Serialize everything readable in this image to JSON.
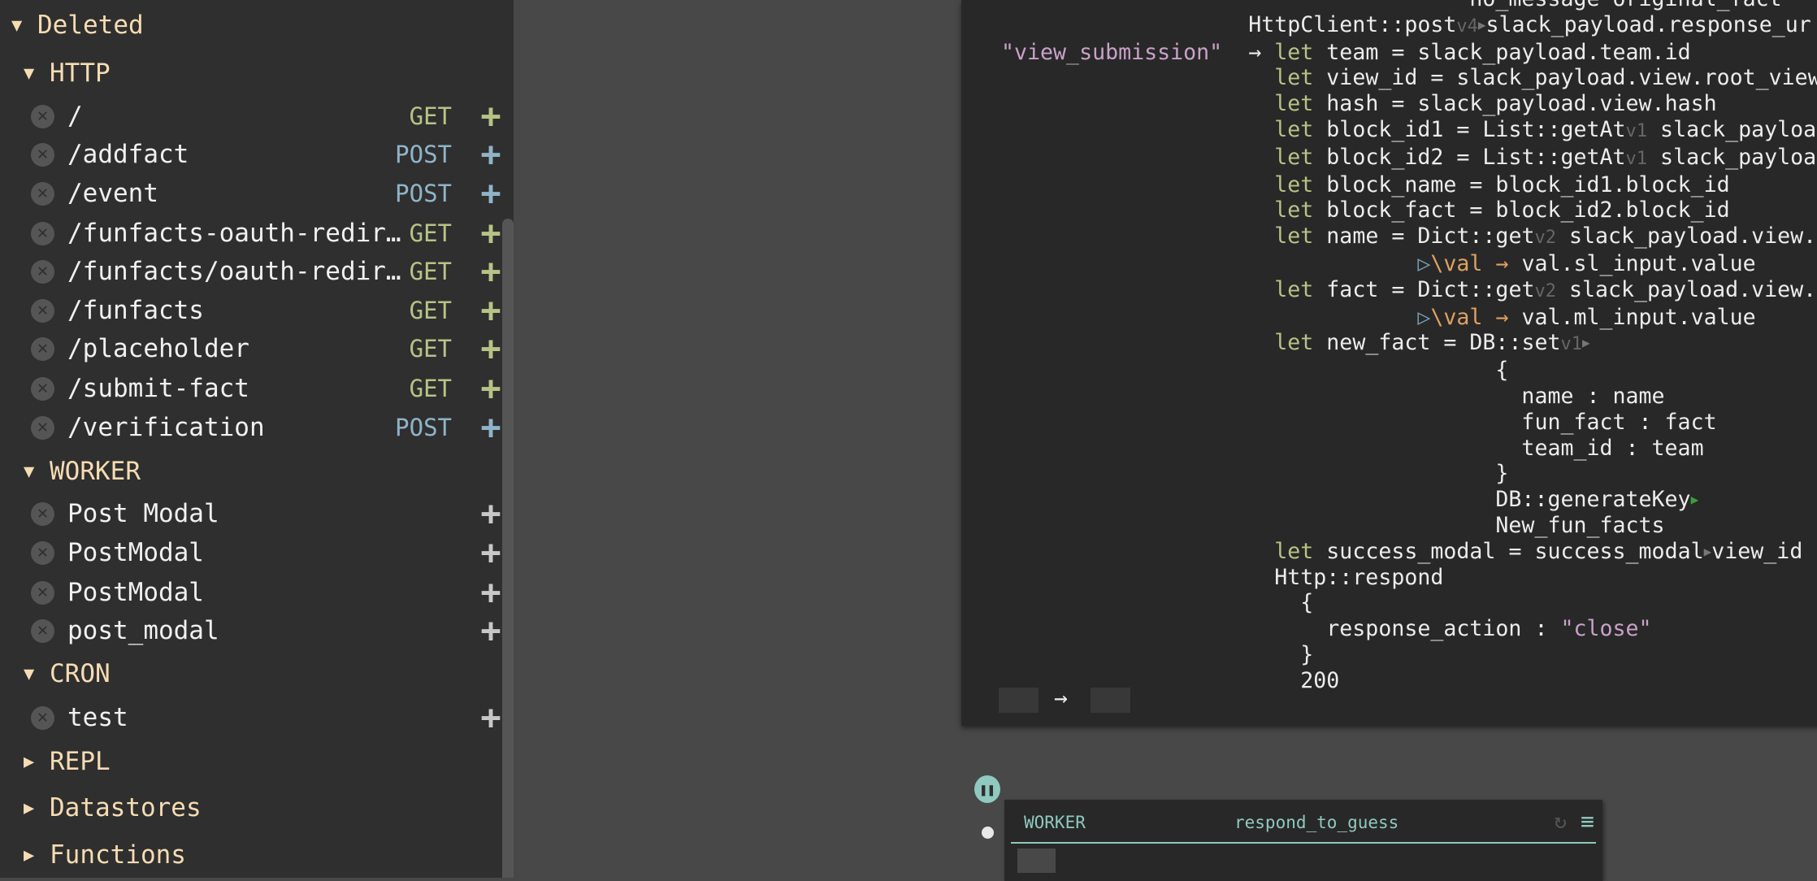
{
  "sidebar": {
    "deleted": "Deleted",
    "http": {
      "title": "HTTP",
      "items": [
        {
          "name": "/",
          "method": "GET"
        },
        {
          "name": "/addfact",
          "method": "POST"
        },
        {
          "name": "/event",
          "method": "POST"
        },
        {
          "name": "/funfacts-oauth-redir…",
          "method": "GET"
        },
        {
          "name": "/funfacts/oauth-redir…",
          "method": "GET"
        },
        {
          "name": "/funfacts",
          "method": "GET"
        },
        {
          "name": "/placeholder",
          "method": "GET"
        },
        {
          "name": "/submit-fact",
          "method": "GET"
        },
        {
          "name": "/verification",
          "method": "POST"
        }
      ]
    },
    "worker": {
      "title": "WORKER",
      "items": [
        {
          "name": "Post Modal"
        },
        {
          "name": "PostModal"
        },
        {
          "name": "PostModal"
        },
        {
          "name": "post_modal"
        }
      ]
    },
    "cron": {
      "title": "CRON",
      "items": [
        {
          "name": "test"
        }
      ]
    },
    "collapsed": [
      "REPL",
      "Datastores",
      "Functions"
    ],
    "colors": {
      "header": "#f6dcb3",
      "get": "#b7c386",
      "post": "#8fb4c8"
    }
  },
  "code_lines": [
    [
      [
        "t",
        "                                    no_message original_fact"
      ]
    ],
    [
      [
        "t",
        "                   HttpClient::post"
      ],
      [
        "ver",
        "v4"
      ],
      [
        "gtri",
        "▶"
      ],
      [
        "t",
        "slack_payload.response_ur"
      ]
    ],
    [
      [
        "str",
        "\"view_submission\""
      ],
      [
        "t",
        "  → "
      ],
      [
        "kw",
        "let"
      ],
      [
        "t",
        " team = slack_payload.team.id"
      ]
    ],
    [
      [
        "t",
        "                     "
      ],
      [
        "kw",
        "let"
      ],
      [
        "t",
        " view_id = slack_payload.view.root_view"
      ]
    ],
    [
      [
        "t",
        "                     "
      ],
      [
        "kw",
        "let"
      ],
      [
        "t",
        " hash = slack_payload.view.hash"
      ]
    ],
    [
      [
        "t",
        "                     "
      ],
      [
        "kw",
        "let"
      ],
      [
        "t",
        " block_id1 = List::getAt"
      ],
      [
        "ver",
        "v1"
      ],
      [
        "t",
        " slack_payloa"
      ]
    ],
    [
      [
        "t",
        "                     "
      ],
      [
        "kw",
        "let"
      ],
      [
        "t",
        " block_id2 = List::getAt"
      ],
      [
        "ver",
        "v1"
      ],
      [
        "t",
        " slack_payloa"
      ]
    ],
    [
      [
        "t",
        "                     "
      ],
      [
        "kw",
        "let"
      ],
      [
        "t",
        " block_name = block_id1.block_id"
      ]
    ],
    [
      [
        "t",
        "                     "
      ],
      [
        "kw",
        "let"
      ],
      [
        "t",
        " block_fact = block_id2.block_id"
      ]
    ],
    [
      [
        "t",
        "                     "
      ],
      [
        "kw",
        "let"
      ],
      [
        "t",
        " name = Dict::get"
      ],
      [
        "ver",
        "v2"
      ],
      [
        "t",
        " slack_payload.view."
      ]
    ],
    [
      [
        "t",
        "                                "
      ],
      [
        "pipe",
        "▷"
      ],
      [
        "lam",
        "\\val → "
      ],
      [
        "t",
        "val.sl_input.value"
      ]
    ],
    [
      [
        "t",
        "                     "
      ],
      [
        "kw",
        "let"
      ],
      [
        "t",
        " fact = Dict::get"
      ],
      [
        "ver",
        "v2"
      ],
      [
        "t",
        " slack_payload.view."
      ]
    ],
    [
      [
        "t",
        "                                "
      ],
      [
        "pipe",
        "▷"
      ],
      [
        "lam",
        "\\val → "
      ],
      [
        "t",
        "val.ml_input.value"
      ]
    ],
    [
      [
        "t",
        "                     "
      ],
      [
        "kw",
        "let"
      ],
      [
        "t",
        " new_fact = DB::set"
      ],
      [
        "ver",
        "v1"
      ],
      [
        "gtri",
        "▶"
      ]
    ],
    [
      [
        "t",
        "                                      {"
      ]
    ],
    [
      [
        "t",
        "                                        name : name"
      ]
    ],
    [
      [
        "t",
        "                                        fun_fact : fact"
      ]
    ],
    [
      [
        "t",
        "                                        team_id : team"
      ]
    ],
    [
      [
        "t",
        "                                      }"
      ]
    ],
    [
      [
        "t",
        "                                      DB::generateKey"
      ],
      [
        "grtri",
        "▶"
      ]
    ],
    [
      [
        "t",
        "                                      New_fun_facts"
      ]
    ],
    [
      [
        "t",
        "                     "
      ],
      [
        "kw",
        "let"
      ],
      [
        "t",
        " success_modal = success_modal"
      ],
      [
        "gtri",
        "▶"
      ],
      [
        "t",
        "view_id"
      ]
    ],
    [
      [
        "t",
        "                     Http::respond"
      ]
    ],
    [
      [
        "t",
        "                       {"
      ]
    ],
    [
      [
        "t",
        "                         response_action : "
      ],
      [
        "str",
        "\"close\""
      ]
    ],
    [
      [
        "t",
        "                       }"
      ]
    ],
    [
      [
        "t",
        "                       200"
      ]
    ]
  ],
  "code_footer": {
    "arrow": "→"
  },
  "worker_panel": {
    "type": "WORKER",
    "name": "respond_to_guess",
    "refresh_icon": "refresh-icon",
    "menu_icon": "hamburger-menu-icon",
    "accent": "#8fc9bf"
  }
}
